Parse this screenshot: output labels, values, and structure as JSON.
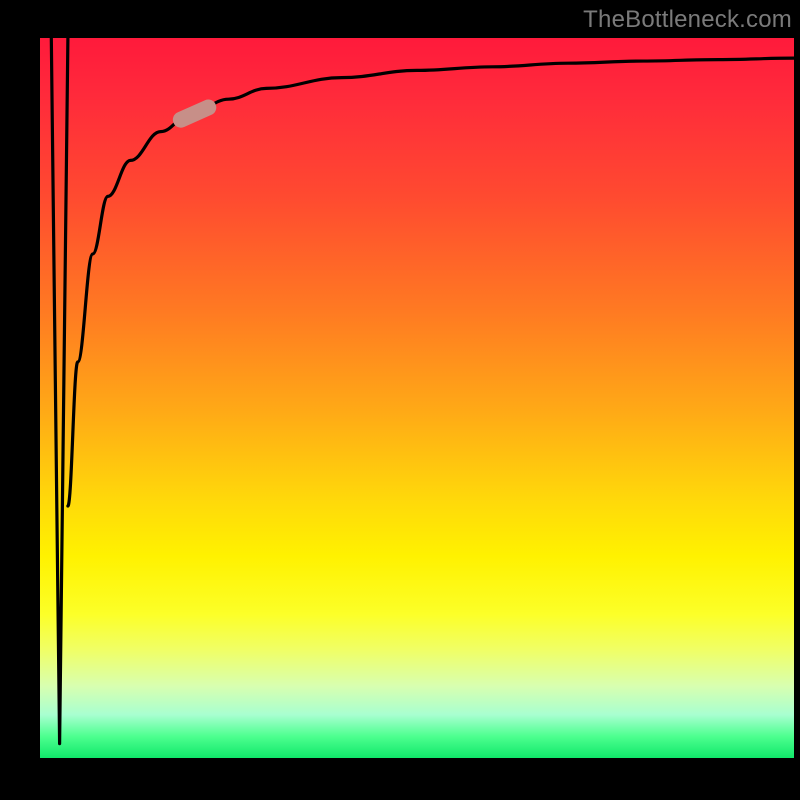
{
  "attribution": "TheBottleneck.com",
  "colors": {
    "bg": "#000000",
    "gradient_top": "#ff1a3b",
    "gradient_bottom": "#10e86a",
    "curve": "#000000",
    "marker_fill": "#c78f88",
    "marker_stroke": "#9f6a64",
    "attribution_text": "#7a7a7a"
  },
  "chart_data": {
    "type": "line",
    "title": "",
    "xlabel": "",
    "ylabel": "",
    "xlim": [
      0,
      100
    ],
    "ylim": [
      0,
      100
    ],
    "series": [
      {
        "name": "spike-down",
        "x": [
          1.5,
          2.6,
          3.7
        ],
        "values": [
          100,
          2,
          100
        ]
      },
      {
        "name": "log-rise",
        "x": [
          3.7,
          5,
          7,
          9,
          12,
          16,
          20,
          25,
          30,
          40,
          50,
          60,
          70,
          80,
          90,
          100
        ],
        "values": [
          35,
          55,
          70,
          78,
          83,
          87,
          89.5,
          91.5,
          93,
          94.5,
          95.5,
          96,
          96.5,
          96.8,
          97,
          97.2
        ]
      }
    ],
    "annotations": [
      {
        "name": "marker-pill",
        "x": 20.5,
        "y": 89.5,
        "angle_deg": -24
      }
    ],
    "background": {
      "type": "vertical-gradient",
      "top": "red",
      "bottom": "green",
      "meaning": "bottleneck-severity-heatmap"
    }
  }
}
